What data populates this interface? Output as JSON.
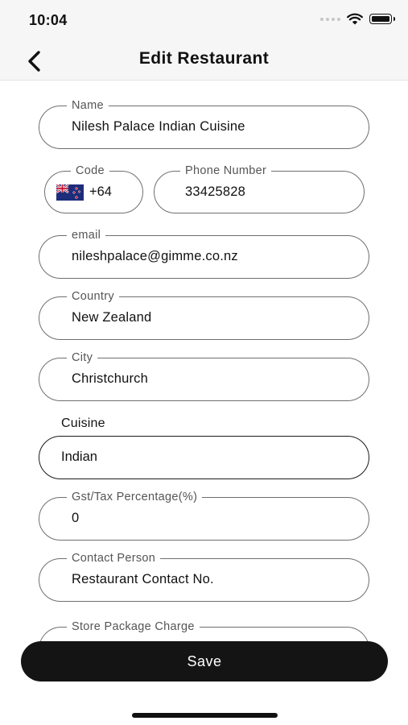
{
  "status_bar": {
    "time": "10:04"
  },
  "nav": {
    "title": "Edit Restaurant",
    "back_icon": "chevron-left-icon"
  },
  "form": {
    "name": {
      "label": "Name",
      "value": "Nilesh Palace Indian Cuisine"
    },
    "code": {
      "label": "Code",
      "value": "+64",
      "flag": "new-zealand-flag"
    },
    "phone": {
      "label": "Phone Number",
      "value": "33425828"
    },
    "email": {
      "label": "email",
      "value": "nileshpalace@gimme.co.nz"
    },
    "country": {
      "label": "Country",
      "value": "New Zealand"
    },
    "city": {
      "label": "City",
      "value": "Christchurch"
    },
    "cuisine": {
      "label": "Cuisine",
      "value": "Indian"
    },
    "gst": {
      "label": "Gst/Tax Percentage(%)",
      "value": "0"
    },
    "contact": {
      "label": "Contact Person",
      "value": "Restaurant Contact No."
    },
    "package_charge": {
      "label": "Store Package Charge",
      "value": ""
    }
  },
  "actions": {
    "save_label": "Save"
  },
  "colors": {
    "primary_button": "#141414",
    "field_border": "#6f6f6f",
    "bar_background": "#f6f6f6"
  }
}
